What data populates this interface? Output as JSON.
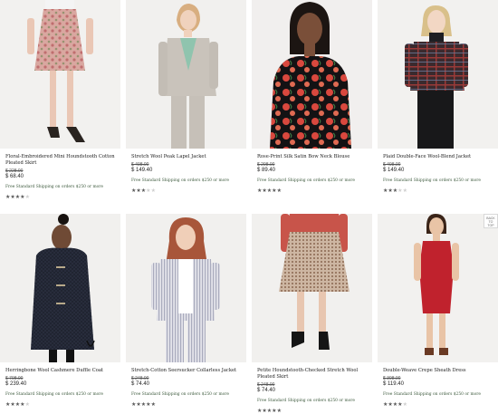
{
  "products": [
    {
      "name": "Floral-Embroidered Mini Houndstooth Cotton Pleated Skirt",
      "original_price": "$ 228.00",
      "price": "$ 68.40",
      "shipping": "Free Standard Shipping on orders $250 or more",
      "rating": 4
    },
    {
      "name": "Stretch Wool Peak Lapel Jacket",
      "original_price": "$ 498.00",
      "price": "$ 149.40",
      "shipping": "Free Standard Shipping on orders $250 or more",
      "rating": 3
    },
    {
      "name": "Rose-Print Silk Satin Bow Neck Blouse",
      "original_price": "$ 298.00",
      "price": "$ 89.40",
      "shipping": "Free Standard Shipping on orders $250 or more",
      "rating": 5
    },
    {
      "name": "Plaid Double-Face Wool-Blend Jacket",
      "original_price": "$ 498.00",
      "price": "$ 149.40",
      "shipping": "Free Standard Shipping on orders $250 or more",
      "rating": 3
    },
    {
      "name": "Herringbone Wool Cashmere Duffle Coat",
      "original_price": "$ 798.00",
      "price": "$ 239.40",
      "shipping": "Free Standard Shipping on orders $250 or more",
      "rating": 4
    },
    {
      "name": "Stretch-Cotton Seersucker Collarless Jacket",
      "original_price": "$ 248.00",
      "price": "$ 74.40",
      "shipping": "Free Standard Shipping on orders $250 or more",
      "rating": 5
    },
    {
      "name": "Petite Houndstooth-Checked Stretch Wool Pleated Skirt",
      "original_price": "$ 248.00",
      "price": "$ 74.40",
      "shipping": "Free Standard Shipping on orders $250 or more",
      "rating": 5
    },
    {
      "name": "Double-Weave Crepe Sheath Dress",
      "original_price": "$ 398.00",
      "price": "$ 119.40",
      "shipping": "Free Standard Shipping on orders $250 or more",
      "rating": 4
    }
  ],
  "back_to_top": {
    "line1": "BACK",
    "line2": "TO",
    "line3": "TOP"
  },
  "colors": {
    "photo_bg": "#f0f0ef",
    "text": "#222222",
    "shipping_text": "#3d5a3d",
    "star_on": "#5a5a5a",
    "star_off": "#cfcfcf"
  }
}
